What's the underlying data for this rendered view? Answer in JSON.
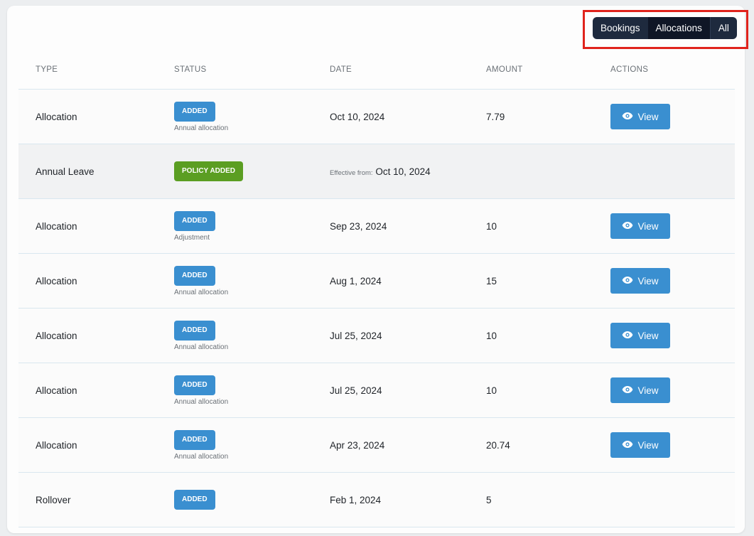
{
  "filter": {
    "options": [
      "Bookings",
      "Allocations",
      "All"
    ],
    "active": "Allocations"
  },
  "columns": [
    "TYPE",
    "STATUS",
    "DATE",
    "AMOUNT",
    "ACTIONS"
  ],
  "rows": [
    {
      "type": "Allocation",
      "badge": "ADDED",
      "badge_color": "#3a8fd0",
      "sub": "Annual allocation",
      "date": "Oct 10, 2024",
      "amount": "7.79",
      "action": "View"
    },
    {
      "type": "Annual Leave",
      "badge": "POLICY ADDED",
      "badge_color": "#5b9e22",
      "effective_label": "Effective from:",
      "date": "Oct 10, 2024"
    },
    {
      "type": "Allocation",
      "badge": "ADDED",
      "badge_color": "#3a8fd0",
      "sub": "Adjustment",
      "date": "Sep 23, 2024",
      "amount": "10",
      "action": "View"
    },
    {
      "type": "Allocation",
      "badge": "ADDED",
      "badge_color": "#3a8fd0",
      "sub": "Annual allocation",
      "date": "Aug 1, 2024",
      "amount": "15",
      "action": "View"
    },
    {
      "type": "Allocation",
      "badge": "ADDED",
      "badge_color": "#3a8fd0",
      "sub": "Annual allocation",
      "date": "Jul 25, 2024",
      "amount": "10",
      "action": "View"
    },
    {
      "type": "Allocation",
      "badge": "ADDED",
      "badge_color": "#3a8fd0",
      "sub": "Annual allocation",
      "date": "Jul 25, 2024",
      "amount": "10",
      "action": "View"
    },
    {
      "type": "Allocation",
      "badge": "ADDED",
      "badge_color": "#3a8fd0",
      "sub": "Annual allocation",
      "date": "Apr 23, 2024",
      "amount": "20.74",
      "action": "View"
    },
    {
      "type": "Rollover",
      "badge": "ADDED",
      "badge_color": "#3a8fd0",
      "date": "Feb 1, 2024",
      "amount": "5"
    }
  ],
  "icons": {
    "view": "eye-icon"
  },
  "colors": {
    "accent": "#3a8fd0",
    "policy": "#5b9e22",
    "highlight": "#e0231c",
    "filter_bg": "#1e2a3e"
  }
}
